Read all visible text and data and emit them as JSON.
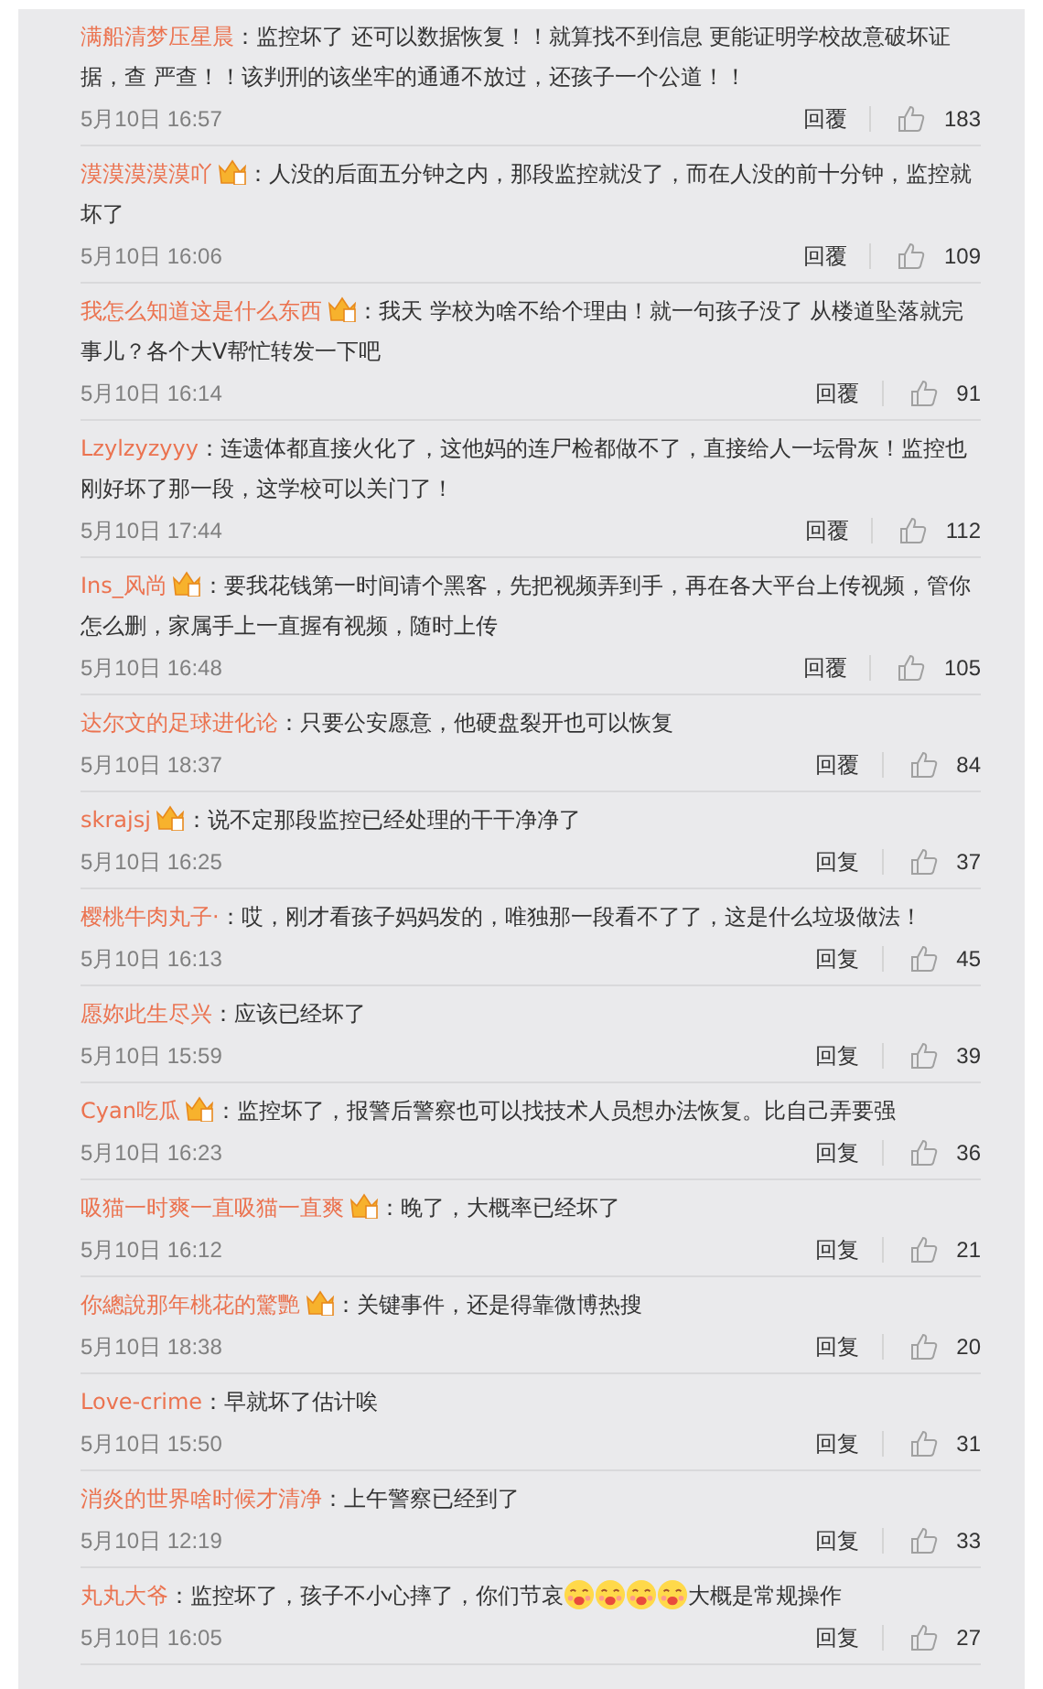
{
  "comments": [
    {
      "name": "满船清梦压星晨",
      "badge": false,
      "text": "：监控坏了 还可以数据恢复！！就算找不到信息 更能证明学校故意破坏证据，查 严查！！该判刑的该坐牢的通通不放过，还孩子一个公道！！",
      "time": "5月10日 16:57",
      "reply": "回覆",
      "likes": "183"
    },
    {
      "name": "漠漠漠漠漠吖",
      "badge": true,
      "text": "：人没的后面五分钟之内，那段监控就没了，而在人没的前十分钟，监控就坏了",
      "time": "5月10日 16:06",
      "reply": "回覆",
      "likes": "109"
    },
    {
      "name": "我怎么知道这是什么东西",
      "badge": true,
      "text": "：我天 学校为啥不给个理由！就一句孩子没了 从楼道坠落就完事儿？各个大V帮忙转发一下吧",
      "time": "5月10日 16:14",
      "reply": "回覆",
      "likes": "91"
    },
    {
      "name": "Lzylzyzyyy",
      "badge": false,
      "text": "：连遗体都直接火化了，这他妈的连尸检都做不了，直接给人一坛骨灰！监控也刚好坏了那一段，这学校可以关门了！",
      "time": "5月10日 17:44",
      "reply": "回覆",
      "likes": "112"
    },
    {
      "name": "Ins_风尚",
      "badge": true,
      "text": "：要我花钱第一时间请个黑客，先把视频弄到手，再在各大平台上传视频，管你怎么删，家属手上一直握有视频，随时上传",
      "time": "5月10日 16:48",
      "reply": "回覆",
      "likes": "105"
    },
    {
      "name": "达尔文的足球进化论",
      "badge": false,
      "text": "：只要公安愿意，他硬盘裂开也可以恢复",
      "time": "5月10日 18:37",
      "reply": "回覆",
      "likes": "84"
    },
    {
      "name": "skrajsj",
      "badge": true,
      "text": "：说不定那段监控已经处理的干干净净了",
      "time": "5月10日 16:25",
      "reply": "回复",
      "likes": "37"
    },
    {
      "name": "樱桃牛肉丸子·",
      "badge": false,
      "text": "：哎，刚才看孩子妈妈发的，唯独那一段看不了了，这是什么垃圾做法！",
      "time": "5月10日 16:13",
      "reply": "回复",
      "likes": "45"
    },
    {
      "name": "愿妳此生尽兴",
      "badge": false,
      "text": "：应该已经坏了",
      "time": "5月10日 15:59",
      "reply": "回复",
      "likes": "39"
    },
    {
      "name": "Cyan吃瓜",
      "badge": true,
      "text": "：监控坏了，报警后警察也可以找技术人员想办法恢复。比自己弄要强",
      "time": "5月10日 16:23",
      "reply": "回复",
      "likes": "36"
    },
    {
      "name": "吸猫一时爽一直吸猫一直爽",
      "badge": true,
      "text": "：晚了，大概率已经坏了",
      "time": "5月10日 16:12",
      "reply": "回复",
      "likes": "21"
    },
    {
      "name": "你總說那年桃花的驚艷",
      "badge": true,
      "text": "：关键事件，还是得靠微博热搜",
      "time": "5月10日 18:38",
      "reply": "回复",
      "likes": "20"
    },
    {
      "name": "Love-crime",
      "badge": false,
      "text": "：早就坏了估计唉",
      "time": "5月10日 15:50",
      "reply": "回复",
      "likes": "31"
    },
    {
      "name": "消炎的世界啥时候才清净",
      "badge": false,
      "text": "：上午警察已经到了",
      "time": "5月10日 12:19",
      "reply": "回复",
      "likes": "33"
    },
    {
      "name": "丸丸大爷",
      "badge": false,
      "parts": [
        {
          "kind": "text",
          "text": "：监控坏了，孩子不小心摔了，你们节哀"
        },
        {
          "kind": "emoji"
        },
        {
          "kind": "emoji"
        },
        {
          "kind": "emoji"
        },
        {
          "kind": "emoji"
        },
        {
          "kind": "text",
          "text": "大概是常规操作"
        }
      ],
      "time": "5月10日 16:05",
      "reply": "回复",
      "likes": "27"
    }
  ]
}
